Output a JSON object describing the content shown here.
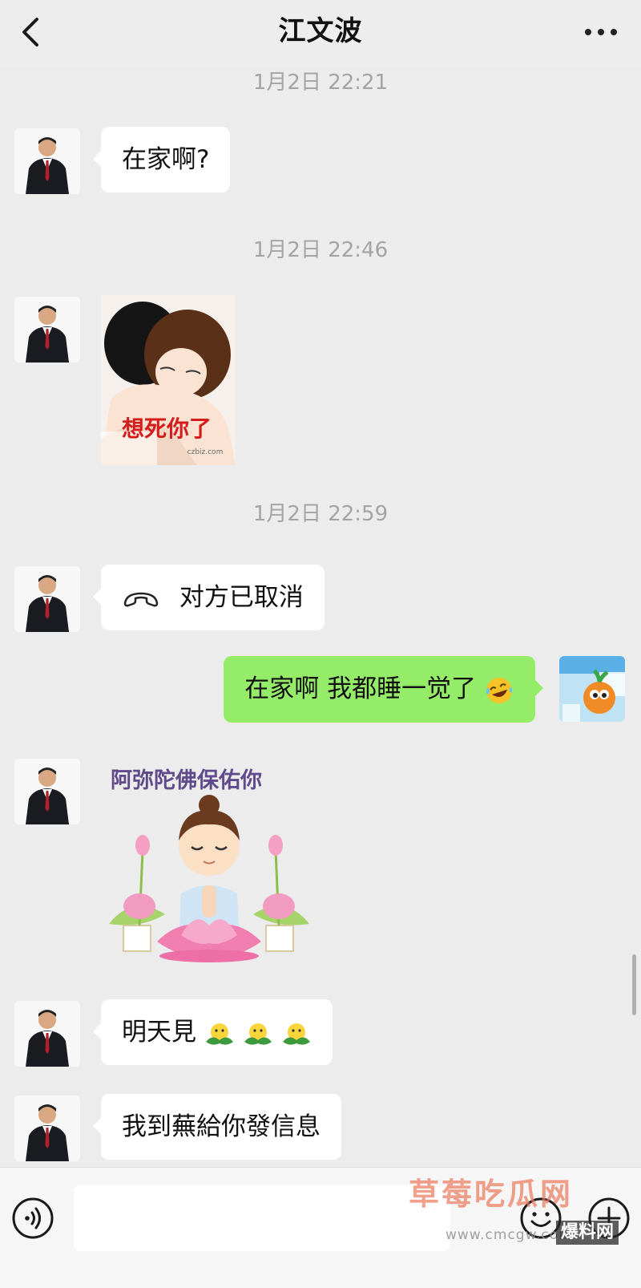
{
  "header": {
    "title": "江文波"
  },
  "messages": [
    {
      "type": "timestamp",
      "text": "1月2日 22:21"
    },
    {
      "type": "text",
      "side": "left",
      "text": "在家啊?"
    },
    {
      "type": "timestamp",
      "text": "1月2日 22:46"
    },
    {
      "type": "sticker",
      "side": "left",
      "caption": "想死你了",
      "small_text": "czbiz.com"
    },
    {
      "type": "timestamp",
      "text": "1月2日 22:59"
    },
    {
      "type": "call",
      "side": "left",
      "icon": "phone-hangup-icon",
      "text": "对方已取消"
    },
    {
      "type": "text",
      "side": "right",
      "text": "在家啊 我都睡一觉了",
      "emoji": "laughing-crying-emoji-icon"
    },
    {
      "type": "sticker",
      "side": "left",
      "caption": "阿弥陀佛保佑你"
    },
    {
      "type": "text",
      "side": "left",
      "text": "明天見",
      "emoji_count": 3,
      "emoji": "sprout-emoji-icon"
    },
    {
      "type": "text",
      "side": "left",
      "text": "我到蕪給你發信息"
    }
  ],
  "watermark": {
    "text": "草莓吃瓜网",
    "url": "www.cmcgw.com",
    "tag": "爆料网"
  },
  "colors": {
    "background": "#ececec",
    "bubble_left": "#ffffff",
    "bubble_right": "#95ec69",
    "timestamp": "#a4a4a4"
  }
}
